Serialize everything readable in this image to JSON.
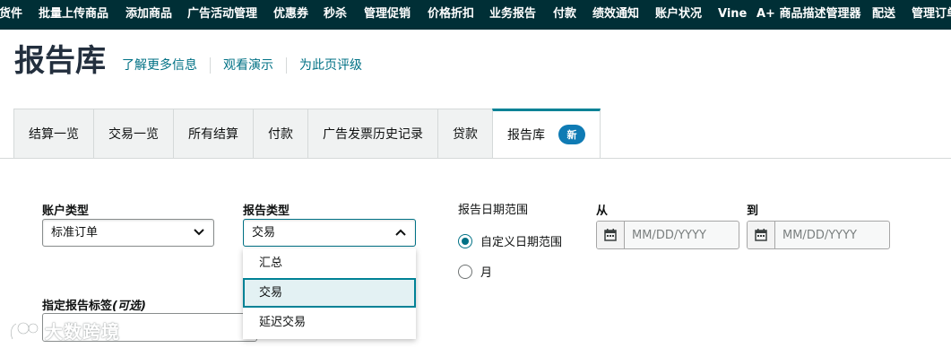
{
  "topnav": {
    "items": [
      "货件",
      "批量上传商品",
      "添加商品",
      "广告活动管理",
      "优惠券",
      "秒杀",
      "管理促销",
      "价格折扣",
      "业务报告",
      "付款",
      "绩效通知",
      "账户状况",
      "Vine",
      "A+ 商品描述管理器",
      "配送",
      "管理订单"
    ]
  },
  "header": {
    "title": "报告库",
    "links": [
      "了解更多信息",
      "观看演示",
      "为此页评级"
    ]
  },
  "tabs": {
    "items": [
      "结算一览",
      "交易一览",
      "所有结算",
      "付款",
      "广告发票历史记录",
      "贷款",
      "报告库"
    ],
    "active": "报告库",
    "badge": "新"
  },
  "form": {
    "account_type": {
      "label": "账户类型",
      "value": "标准订单"
    },
    "report_type": {
      "label": "报告类型",
      "value": "交易",
      "options": [
        "汇总",
        "交易",
        "延迟交易"
      ],
      "selected": "交易"
    },
    "date_range": {
      "label": "报告日期范围",
      "options": [
        "自定义日期范围",
        "月"
      ],
      "selected": "自定义日期范围"
    },
    "from": {
      "label": "从",
      "placeholder": "MM/DD/YYYY"
    },
    "to": {
      "label": "到",
      "placeholder": "MM/DD/YYYY"
    },
    "report_tag": {
      "label": "指定报告标签",
      "optional": "(可选)"
    }
  },
  "watermark": {
    "text": "大数跨境"
  },
  "colors": {
    "nav_bg": "#002f36",
    "link": "#007185",
    "tab_accent": "#008296",
    "badge": "#0f7bb4"
  }
}
